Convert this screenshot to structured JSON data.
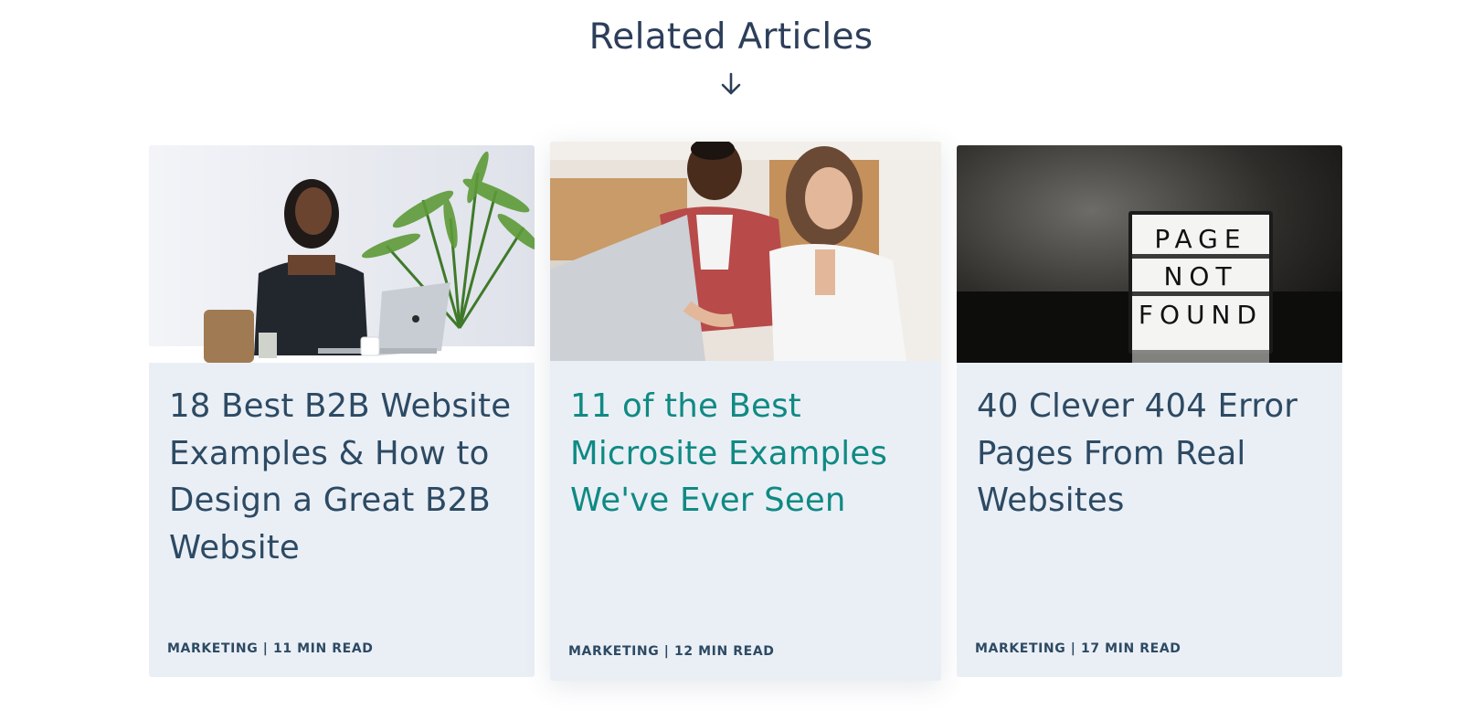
{
  "section": {
    "heading": "Related Articles"
  },
  "colors": {
    "title": "#2d4a63",
    "title_hover": "#0f8a83",
    "card_bg": "#eaeff6"
  },
  "cards": [
    {
      "title": "18 Best B2B Website Examples & How to Design a Great B2B Website",
      "meta": "MARKETING | 11 MIN READ",
      "image": "woman-working-on-laptop-photo"
    },
    {
      "title": "11 of the Best Microsite Examples We've Ever Seen",
      "meta": "MARKETING | 12 MIN READ",
      "image": "two-people-looking-at-laptop-photo"
    },
    {
      "title": "40 Clever 404 Error Pages From Real Websites",
      "meta": "MARKETING | 17 MIN READ",
      "image": "page-not-found-lightbox-photo",
      "image_text": [
        "PAGE",
        "NOT",
        "FOUND"
      ]
    }
  ]
}
